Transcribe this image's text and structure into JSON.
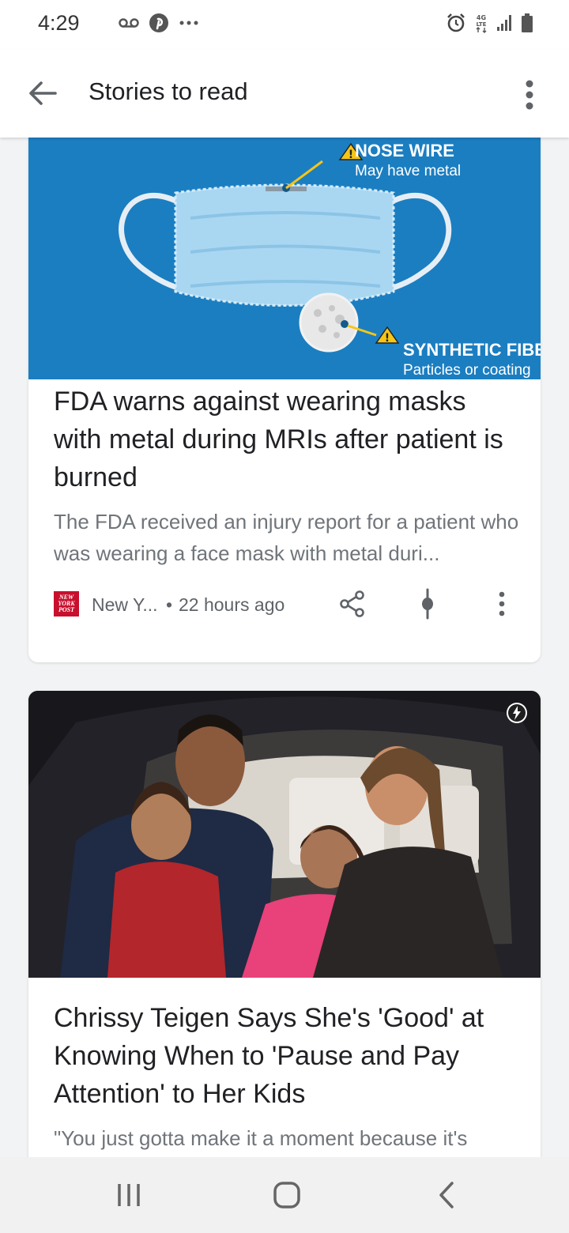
{
  "status_bar": {
    "time": "4:29",
    "icons_left": [
      "voicemail-icon",
      "pinterest-icon",
      "more-dots-icon"
    ],
    "icons_right": [
      "alarm-icon",
      "lte-data-icon",
      "signal-icon",
      "battery-icon"
    ],
    "network_label": "4G LTE"
  },
  "app_bar": {
    "title": "Stories to read",
    "back_icon": "arrow-back-icon",
    "menu_icon": "more-vert-icon"
  },
  "stories": [
    {
      "image_labels": {
        "nose_wire_title": "NOSE WIRE",
        "nose_wire_sub": "May have metal",
        "fiber_title": "SYNTHETIC FIBE",
        "fiber_sub": "Particles or coating"
      },
      "headline": "FDA warns against wearing masks with metal during MRIs after patient is burned",
      "snippet": "The FDA received an injury report for a patient who was wearing a face mask with metal duri...",
      "source": "New Y...",
      "source_logo_text": "NEW YORK POST",
      "separator": "•",
      "time": "22 hours ago"
    },
    {
      "headline": "Chrissy Teigen Says She's 'Good' at Knowing When to 'Pause and Pay Attention' to Her Kids",
      "snippet": "\"You just gotta make it a moment because it's"
    }
  ],
  "colors": {
    "mask_bg": "#1b7ec1",
    "source_red": "#c8102e",
    "warning_yellow": "#f5c518"
  },
  "nav_bar": {
    "buttons": [
      "recent-apps-icon",
      "home-icon",
      "back-icon"
    ]
  }
}
